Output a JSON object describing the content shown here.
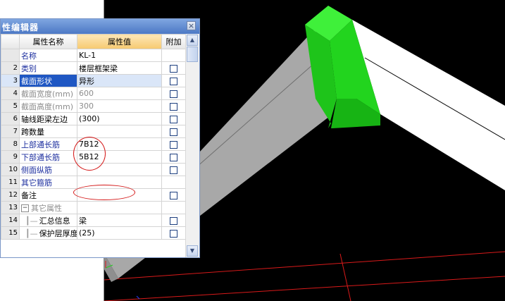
{
  "dialog": {
    "title": "性编辑器",
    "close_label": "×",
    "columns": {
      "name": "属性名称",
      "value": "属性值",
      "extra": "附加"
    },
    "rows": [
      {
        "num": "",
        "name": "名称",
        "value": "KL-1",
        "name_style": "blue",
        "value_style": "",
        "has_checkbox": false,
        "selected": false
      },
      {
        "num": "2",
        "name": "类别",
        "value": "楼层框架梁",
        "name_style": "blue",
        "value_style": "",
        "has_checkbox": true,
        "selected": false
      },
      {
        "num": "3",
        "name": "截面形状",
        "value": "异形",
        "name_style": "",
        "value_style": "",
        "has_checkbox": true,
        "selected": true
      },
      {
        "num": "4",
        "name": "截面宽度(mm)",
        "value": "600",
        "name_style": "gray",
        "value_style": "gray",
        "has_checkbox": true,
        "selected": false
      },
      {
        "num": "5",
        "name": "截面高度(mm)",
        "value": "300",
        "name_style": "gray",
        "value_style": "gray",
        "has_checkbox": true,
        "selected": false
      },
      {
        "num": "6",
        "name": "轴线距梁左边",
        "value": "(300)",
        "name_style": "",
        "value_style": "",
        "has_checkbox": true,
        "selected": false
      },
      {
        "num": "7",
        "name": "跨数量",
        "value": "",
        "name_style": "",
        "value_style": "",
        "has_checkbox": true,
        "selected": false
      },
      {
        "num": "8",
        "name": "上部通长筋",
        "value": "7B12",
        "name_style": "blue",
        "value_style": "",
        "has_checkbox": true,
        "selected": false
      },
      {
        "num": "9",
        "name": "下部通长筋",
        "value": "5B12",
        "name_style": "blue",
        "value_style": "",
        "has_checkbox": true,
        "selected": false
      },
      {
        "num": "10",
        "name": "侧面纵筋",
        "value": "",
        "name_style": "blue",
        "value_style": "",
        "has_checkbox": true,
        "selected": false
      },
      {
        "num": "11",
        "name": "其它箍筋",
        "value": "",
        "name_style": "blue",
        "value_style": "",
        "has_checkbox": false,
        "selected": false
      },
      {
        "num": "12",
        "name": "备注",
        "value": "",
        "name_style": "",
        "value_style": "",
        "has_checkbox": true,
        "selected": false
      },
      {
        "num": "13",
        "name": "其它属性",
        "value": "",
        "name_style": "gray",
        "value_style": "",
        "has_checkbox": false,
        "selected": false,
        "group": true
      },
      {
        "num": "14",
        "name": "汇总信息",
        "value": "梁",
        "name_style": "",
        "value_style": "",
        "has_checkbox": true,
        "selected": false,
        "child": true
      },
      {
        "num": "15",
        "name": "保护层厚度(",
        "value": "(25)",
        "name_style": "",
        "value_style": "",
        "has_checkbox": true,
        "selected": false,
        "child": true
      }
    ],
    "group_expander": "−",
    "tree_branch": "┃—"
  },
  "colors": {
    "viewport_bg": "#000000",
    "beam_gray": "#a8a8a8",
    "beam_white": "#ffffff",
    "beam_green": "#22d41e",
    "grid_red": "#d91a1a",
    "annotation_red": "#d41818"
  },
  "icons": {
    "close": "close-icon",
    "scroll_up": "chevron-up-icon",
    "scroll_down": "chevron-down-icon"
  }
}
